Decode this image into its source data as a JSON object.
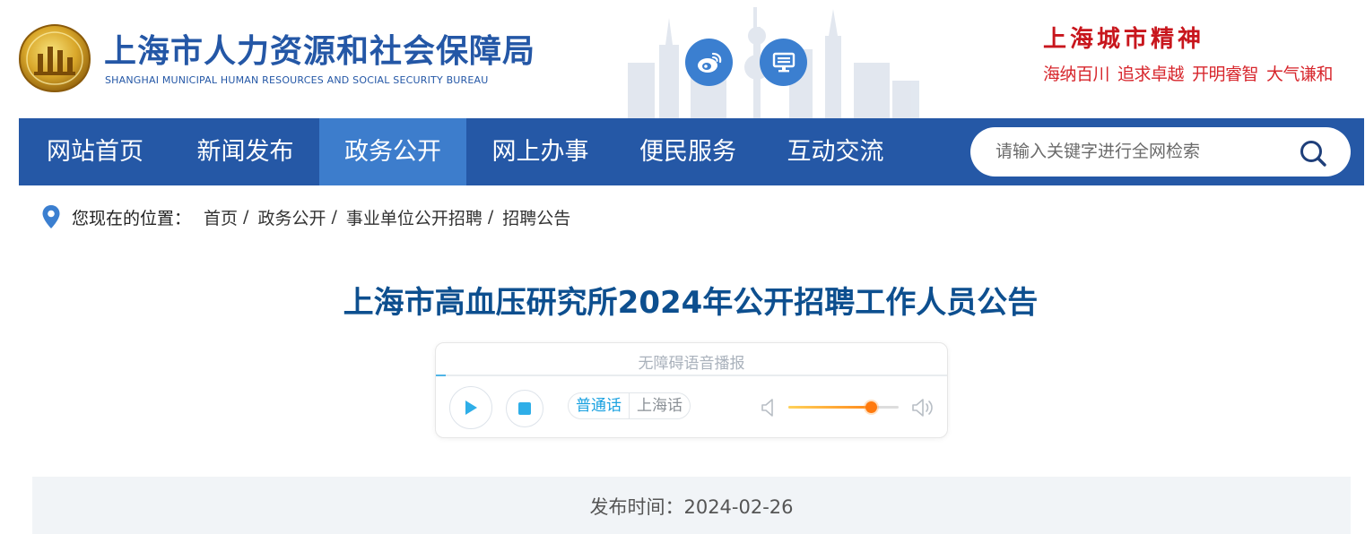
{
  "header": {
    "site_title": "上海市人力资源和社会保障局",
    "site_subtitle": "SHANGHAI MUNICIPAL HUMAN RESOURCES AND SOCIAL SECURITY BUREAU",
    "icons": [
      "weibo-icon",
      "monitor-icon"
    ],
    "city_spirit_title": "上海城市精神",
    "city_spirit_words": [
      "海纳百川",
      "追求卓越",
      "开明睿智",
      "大气谦和"
    ]
  },
  "nav": {
    "items": [
      {
        "label": "网站首页",
        "active": false
      },
      {
        "label": "新闻发布",
        "active": false
      },
      {
        "label": "政务公开",
        "active": true
      },
      {
        "label": "网上办事",
        "active": false
      },
      {
        "label": "便民服务",
        "active": false
      },
      {
        "label": "互动交流",
        "active": false
      }
    ],
    "search_placeholder": "请输入关键字进行全网检索"
  },
  "breadcrumb": {
    "label": "您现在的位置：",
    "items": [
      "首页",
      "政务公开",
      "事业单位公开招聘",
      "招聘公告"
    ],
    "separator": "/"
  },
  "article": {
    "title": "上海市高血压研究所2024年公开招聘工作人员公告",
    "publish_time": "发布时间：2024-02-26"
  },
  "player": {
    "title": "无障碍语音播报",
    "languages": [
      {
        "label": "普通话",
        "active": true
      },
      {
        "label": "上海话",
        "active": false
      }
    ],
    "progress": 0.002,
    "volume": 0.75
  },
  "colors": {
    "brand_blue": "#2558a6",
    "nav_active": "#3d7dcc",
    "title_blue": "#0d4f8f",
    "spirit_red": "#c8161d",
    "accent_cyan": "#1aa1e0",
    "volume_orange": "#ff7a0e"
  }
}
